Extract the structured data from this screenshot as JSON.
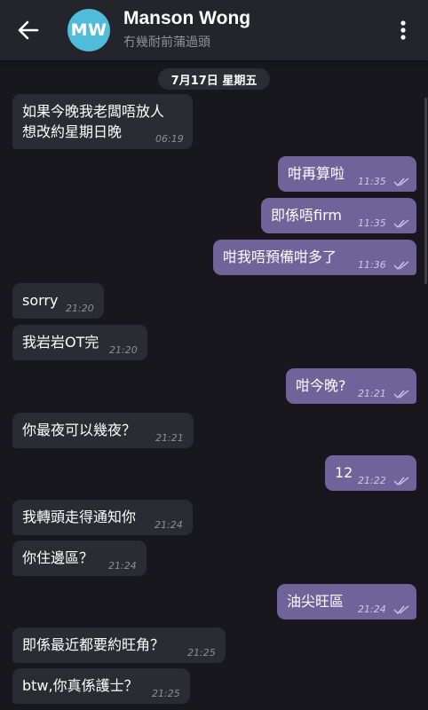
{
  "header": {
    "avatar_initials": "MW",
    "contact_name": "Manson Wong",
    "status": "冇幾耐前蒲過頭",
    "avatar_color": "#4fbcd9"
  },
  "date_separator": "7月17日 星期五",
  "colors": {
    "incoming_bubble": "#2b2b33",
    "outgoing_bubble": "#6f6399",
    "background": "#17171d"
  },
  "messages": [
    {
      "direction": "in",
      "text_line1": "如果今晚我老闆唔放人",
      "text_line2": "想改約星期日晚",
      "time": "06:19"
    },
    {
      "direction": "out",
      "text": "咁再算啦",
      "time": "11:35",
      "read": true
    },
    {
      "direction": "out",
      "text": "即係唔firm",
      "time": "11:35",
      "read": true
    },
    {
      "direction": "out",
      "text": "咁我唔預備咁多了",
      "time": "11:36",
      "read": true
    },
    {
      "direction": "in",
      "text": "sorry",
      "time": "21:20"
    },
    {
      "direction": "in",
      "text": "我岩岩OT完",
      "time": "21:20"
    },
    {
      "direction": "out",
      "text": "咁今晚?",
      "time": "21:21",
      "read": true
    },
    {
      "direction": "in",
      "text": "你最夜可以幾夜？",
      "time": "21:21"
    },
    {
      "direction": "out",
      "text": "12",
      "time": "21:22",
      "read": true
    },
    {
      "direction": "in",
      "text": "我轉頭走得通知你",
      "time": "21:24"
    },
    {
      "direction": "in",
      "text": "你住邊區？",
      "time": "21:24"
    },
    {
      "direction": "out",
      "text": "油尖旺區",
      "time": "21:24",
      "read": true
    },
    {
      "direction": "in",
      "text": "即係最近都要約旺角？",
      "time": "21:25"
    },
    {
      "direction": "in",
      "text": "btw,你真係護士？",
      "time": "21:25"
    }
  ]
}
